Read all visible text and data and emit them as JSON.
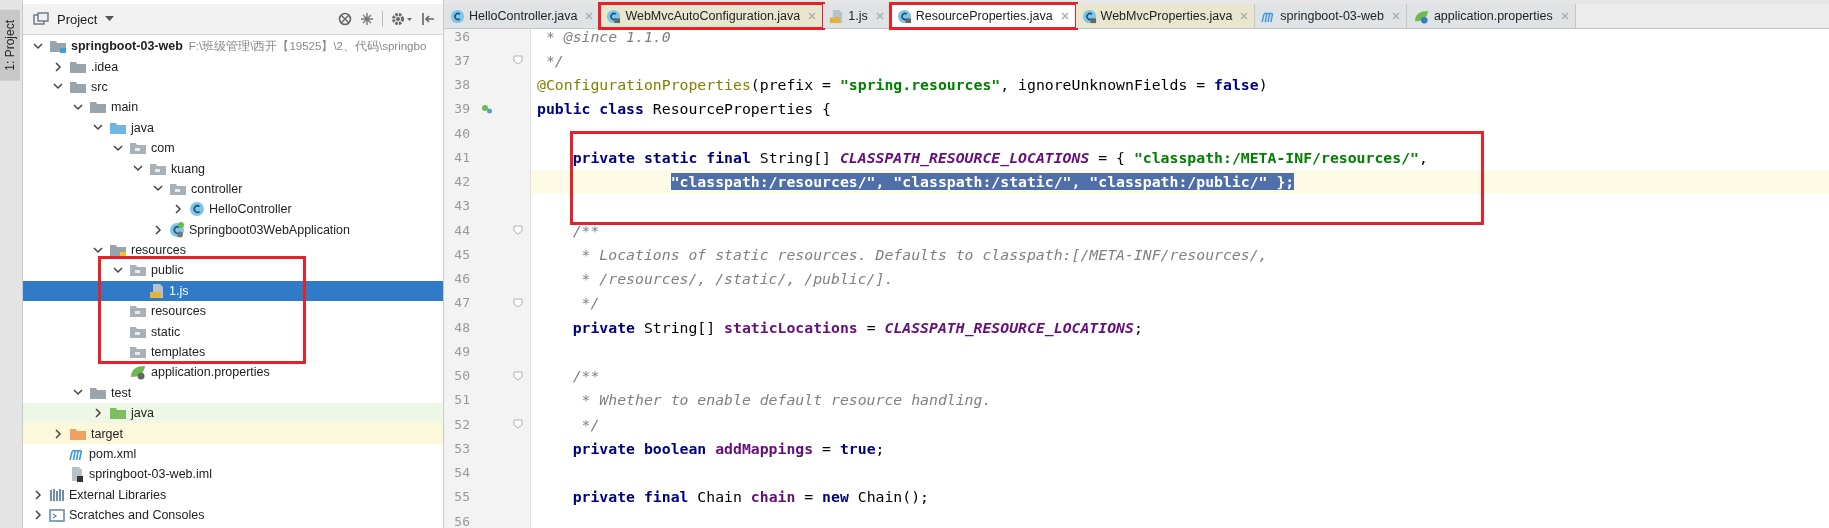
{
  "side_strip": {
    "label": "1: Project"
  },
  "project_panel": {
    "title": "Project",
    "tree": [
      {
        "label": "springboot-03-web",
        "kind": "module",
        "note": "F:\\班级管理\\西开【19525】\\2、代码\\springbo",
        "expanded": true,
        "selected": false,
        "children": [
          {
            "label": ".idea",
            "kind": "folder",
            "expanded": false,
            "selected": false
          },
          {
            "label": "src",
            "kind": "folder",
            "expanded": true,
            "selected": false,
            "children": [
              {
                "label": "main",
                "kind": "folder",
                "expanded": true,
                "selected": false,
                "children": [
                  {
                    "label": "java",
                    "kind": "source-folder",
                    "expanded": true,
                    "selected": false,
                    "children": [
                      {
                        "label": "com",
                        "kind": "package",
                        "expanded": true,
                        "selected": false,
                        "children": [
                          {
                            "label": "kuang",
                            "kind": "package",
                            "expanded": true,
                            "selected": false,
                            "children": [
                              {
                                "label": "controller",
                                "kind": "package",
                                "expanded": true,
                                "selected": false,
                                "children": [
                                  {
                                    "label": "HelloController",
                                    "kind": "class",
                                    "expanded": false,
                                    "selected": false
                                  }
                                ]
                              },
                              {
                                "label": "Springboot03WebApplication",
                                "kind": "spring-class",
                                "expanded": false,
                                "selected": false
                              }
                            ]
                          }
                        ]
                      }
                    ]
                  },
                  {
                    "label": "resources",
                    "kind": "resources-folder",
                    "expanded": true,
                    "selected": false,
                    "children": [
                      {
                        "label": "public",
                        "kind": "package",
                        "expanded": true,
                        "selected": false,
                        "children": [
                          {
                            "label": "1.js",
                            "kind": "js",
                            "selected": true
                          }
                        ]
                      },
                      {
                        "label": "resources",
                        "kind": "package",
                        "selected": false
                      },
                      {
                        "label": "static",
                        "kind": "package",
                        "selected": false
                      },
                      {
                        "label": "templates",
                        "kind": "package",
                        "selected": false
                      },
                      {
                        "label": "application.properties",
                        "kind": "properties",
                        "selected": false
                      }
                    ]
                  }
                ]
              },
              {
                "label": "test",
                "kind": "folder",
                "expanded": true,
                "selected": false,
                "children": [
                  {
                    "label": "java",
                    "kind": "test-folder",
                    "expanded": false,
                    "selected": false
                  }
                ]
              }
            ]
          },
          {
            "label": "target",
            "kind": "excluded-folder",
            "expanded": false,
            "selected": false
          },
          {
            "label": "pom.xml",
            "kind": "maven",
            "selected": false
          },
          {
            "label": "springboot-03-web.iml",
            "kind": "iml",
            "selected": false
          }
        ]
      },
      {
        "label": "External Libraries",
        "kind": "libraries",
        "expanded": false,
        "selected": false
      },
      {
        "label": "Scratches and Consoles",
        "kind": "scratches",
        "expanded": false,
        "selected": false
      }
    ]
  },
  "editor_tabs": [
    {
      "label": "HelloController.java",
      "kind": "class",
      "selected": false,
      "outlined": false
    },
    {
      "label": "WebMvcAutoConfiguration.java",
      "kind": "class-lib",
      "selected": false,
      "outlined": true
    },
    {
      "label": "1.js",
      "kind": "js",
      "selected": false,
      "outlined": false
    },
    {
      "label": "ResourceProperties.java",
      "kind": "class-lib",
      "selected": true,
      "outlined": true
    },
    {
      "label": "WebMvcProperties.java",
      "kind": "class-lib",
      "selected": false,
      "outlined": false
    },
    {
      "label": "springboot-03-web",
      "kind": "maven",
      "selected": false,
      "outlined": false
    },
    {
      "label": "application.properties",
      "kind": "spring",
      "selected": false,
      "outlined": false
    }
  ],
  "code": [
    {
      "n": "36",
      "fold": false,
      "bean": false,
      "current": false,
      "segs": [
        {
          "t": " * @since 1.1.0",
          "kind": "comment",
          "selected": false
        }
      ]
    },
    {
      "n": "37",
      "fold": true,
      "bean": false,
      "current": false,
      "segs": [
        {
          "t": " */",
          "kind": "comment",
          "selected": false
        }
      ]
    },
    {
      "n": "38",
      "fold": false,
      "bean": false,
      "current": false,
      "segs": [
        {
          "t": "@ConfigurationProperties",
          "kind": "annotation",
          "selected": false
        },
        {
          "t": "(prefix = ",
          "kind": "plain",
          "selected": false
        },
        {
          "t": "\"spring.resources\"",
          "kind": "string",
          "selected": false
        },
        {
          "t": ", ignoreUnknownFields = ",
          "kind": "plain",
          "selected": false
        },
        {
          "t": "false",
          "kind": "keyword",
          "selected": false
        },
        {
          "t": ")",
          "kind": "plain",
          "selected": false
        }
      ]
    },
    {
      "n": "39",
      "fold": false,
      "bean": true,
      "current": false,
      "segs": [
        {
          "t": "public class",
          "kind": "keyword",
          "selected": false
        },
        {
          "t": " ResourceProperties {",
          "kind": "plain",
          "selected": false
        }
      ]
    },
    {
      "n": "40",
      "fold": false,
      "bean": false,
      "current": false
    },
    {
      "n": "41",
      "fold": false,
      "bean": false,
      "current": false,
      "segs": [
        {
          "t": "    private static final",
          "kind": "keyword",
          "selected": false
        },
        {
          "t": " String[] ",
          "kind": "plain",
          "selected": false
        },
        {
          "t": "CLASSPATH_RESOURCE_LOCATIONS",
          "kind": "constant",
          "selected": false
        },
        {
          "t": " = { ",
          "kind": "plain",
          "selected": false
        },
        {
          "t": "\"classpath:/META-INF/resources/\"",
          "kind": "string",
          "selected": false
        },
        {
          "t": ",",
          "kind": "plain",
          "selected": false
        }
      ]
    },
    {
      "n": "42",
      "fold": false,
      "bean": false,
      "current": true,
      "kind": "continuation",
      "segs": [
        {
          "t": "\"classpath:/resources/\", \"classpath:/static/\", \"classpath:/public/\" };",
          "kind": "string",
          "selected": true
        }
      ]
    },
    {
      "n": "43",
      "fold": false,
      "bean": false,
      "current": false
    },
    {
      "n": "44",
      "fold": true,
      "bean": false,
      "current": false,
      "segs": [
        {
          "t": "    /**",
          "kind": "comment",
          "selected": false
        }
      ]
    },
    {
      "n": "45",
      "fold": false,
      "bean": false,
      "current": false,
      "segs": [
        {
          "t": "     * Locations of static resources. Defaults to classpath:[/META-INF/resources/,",
          "kind": "comment",
          "selected": false
        }
      ]
    },
    {
      "n": "46",
      "fold": false,
      "bean": false,
      "current": false,
      "segs": [
        {
          "t": "     * /resources/, /static/, /public/].",
          "kind": "comment",
          "selected": false
        }
      ]
    },
    {
      "n": "47",
      "fold": true,
      "bean": false,
      "current": false,
      "segs": [
        {
          "t": "     */",
          "kind": "comment",
          "selected": false
        }
      ]
    },
    {
      "n": "48",
      "fold": false,
      "bean": false,
      "current": false,
      "segs": [
        {
          "t": "    private",
          "kind": "keyword",
          "selected": false
        },
        {
          "t": " String[] ",
          "kind": "plain",
          "selected": false
        },
        {
          "t": "staticLocations",
          "kind": "field",
          "selected": false
        },
        {
          "t": " = ",
          "kind": "plain",
          "selected": false
        },
        {
          "t": "CLASSPATH_RESOURCE_LOCATIONS",
          "kind": "constant",
          "selected": false
        },
        {
          "t": ";",
          "kind": "plain",
          "selected": false
        }
      ]
    },
    {
      "n": "49",
      "fold": false,
      "bean": false,
      "current": false
    },
    {
      "n": "50",
      "fold": true,
      "bean": false,
      "current": false,
      "segs": [
        {
          "t": "    /**",
          "kind": "comment",
          "selected": false
        }
      ]
    },
    {
      "n": "51",
      "fold": false,
      "bean": false,
      "current": false,
      "segs": [
        {
          "t": "     * Whether to enable default resource handling.",
          "kind": "comment",
          "selected": false
        }
      ]
    },
    {
      "n": "52",
      "fold": true,
      "bean": false,
      "current": false,
      "segs": [
        {
          "t": "     */",
          "kind": "comment",
          "selected": false
        }
      ]
    },
    {
      "n": "53",
      "fold": false,
      "bean": false,
      "current": false,
      "segs": [
        {
          "t": "    private boolean ",
          "kind": "keyword",
          "selected": false
        },
        {
          "t": "addMappings",
          "kind": "field",
          "selected": false
        },
        {
          "t": " = ",
          "kind": "plain",
          "selected": false
        },
        {
          "t": "true",
          "kind": "keyword",
          "selected": false
        },
        {
          "t": ";",
          "kind": "plain",
          "selected": false
        }
      ]
    },
    {
      "n": "54",
      "fold": false,
      "bean": false,
      "current": false
    },
    {
      "n": "55",
      "fold": false,
      "bean": false,
      "current": false,
      "segs": [
        {
          "t": "    private final",
          "kind": "keyword",
          "selected": false
        },
        {
          "t": " Chain ",
          "kind": "plain",
          "selected": false
        },
        {
          "t": "chain",
          "kind": "field",
          "selected": false
        },
        {
          "t": " = ",
          "kind": "plain",
          "selected": false
        },
        {
          "t": "new",
          "kind": "keyword",
          "selected": false
        },
        {
          "t": " Chain();",
          "kind": "plain",
          "selected": false
        }
      ]
    },
    {
      "n": "56",
      "fold": false,
      "bean": false,
      "current": false
    }
  ]
}
